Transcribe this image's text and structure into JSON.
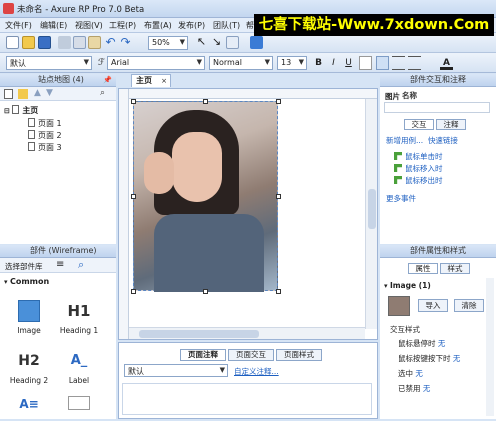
{
  "window": {
    "title": "未命名 - Axure RP Pro 7.0 Beta"
  },
  "watermark": "七喜下载站-Www.7xdown.Com",
  "menu": [
    "文件(F)",
    "编辑(E)",
    "视图(V)",
    "工程(P)",
    "布置(A)",
    "发布(P)",
    "团队(T)",
    "帮"
  ],
  "toolbar": {
    "zoom": "50%"
  },
  "format": {
    "style": "默认",
    "font": "Arial",
    "weight": "Normal",
    "size": "13",
    "bold": "B",
    "italic": "I",
    "underline": "U"
  },
  "sitemap": {
    "title": "站点地图 (4)",
    "root": "主页",
    "pages": [
      "页面 1",
      "页面 2",
      "页面 3"
    ]
  },
  "widgets_panel": {
    "title": "部件 (Wireframe)",
    "library": "选择部件库",
    "category": "Common",
    "items": [
      {
        "label": "Image",
        "glyph": ""
      },
      {
        "label": "Heading 1",
        "glyph": "H1"
      },
      {
        "label": "Heading 2",
        "glyph": "H2"
      },
      {
        "label": "Label",
        "glyph": "A_"
      },
      {
        "label": "",
        "glyph": "A≡"
      },
      {
        "label": "",
        "glyph": ""
      }
    ]
  },
  "canvas": {
    "tab": "主页"
  },
  "notes": {
    "tabs": [
      "页面注释",
      "页面交互",
      "页面样式"
    ],
    "select_value": "默认",
    "custom_link": "自定义注释..."
  },
  "interactions": {
    "title": "部件交互和注释",
    "name_label": "图片",
    "name_placeholder": "名称",
    "tabs": [
      "交互",
      "注释"
    ],
    "link_new": "新增用例...",
    "link_quick": "快速链接",
    "events": [
      "鼠标单击时",
      "鼠标移入时",
      "鼠标移出时"
    ],
    "more": "更多事件"
  },
  "properties": {
    "title": "部件属性和样式",
    "tabs": [
      "属性",
      "样式"
    ],
    "section": "Image (1)",
    "import_btn": "导入",
    "clear_btn": "清除",
    "interaction_style": "交互样式",
    "styles": [
      {
        "label": "鼠标悬停时",
        "value": "无"
      },
      {
        "label": "鼠标按键按下时",
        "value": "无"
      },
      {
        "label": "选中",
        "value": "无"
      },
      {
        "label": "已禁用",
        "value": "无"
      }
    ]
  }
}
